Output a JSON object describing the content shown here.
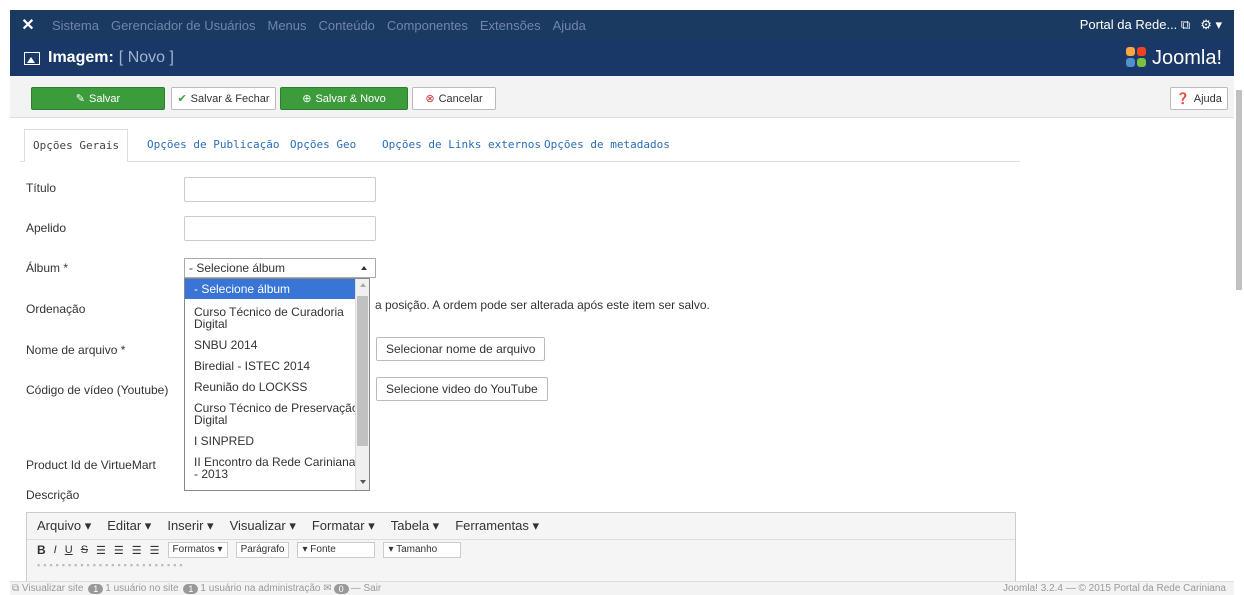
{
  "topbar": {
    "menu": [
      "Sistema",
      "Gerenciador de Usuários",
      "Menus",
      "Conteúdo",
      "Componentes",
      "Extensões",
      "Ajuda"
    ],
    "site_link": "Portal da Rede...",
    "settings": "⚙ ▾"
  },
  "header": {
    "title": "Imagem:",
    "subtitle": "[ Novo ]",
    "logo_text": "Joomla!"
  },
  "toolbar": {
    "save": "Salvar",
    "save_close": "Salvar & Fechar",
    "save_new": "Salvar & Novo",
    "cancel": "Cancelar",
    "help": "Ajuda"
  },
  "tabs": [
    "Opções Gerais",
    "Opções de Publicação",
    "Opções Geo",
    "Opções de Links externos",
    "Opções de metadados"
  ],
  "form": {
    "titulo_label": "Título",
    "apelido_label": "Apelido",
    "album_label": "Álbum *",
    "album_selected": "- Selecione álbum",
    "ordenacao_label": "Ordenação",
    "ordenacao_hint": "a posição. A ordem pode ser alterada após este item ser salvo.",
    "arquivo_label": "Nome de arquivo *",
    "arquivo_button": "Selecionar nome de arquivo",
    "video_label": "Código de vídeo (Youtube)",
    "video_button": "Selecione video do YouTube",
    "virtuemart_label": "Product Id de VirtueMart",
    "descricao_label": "Descrição"
  },
  "album_options": [
    "- Selecione álbum",
    "Curso Técnico de Curadoria Digital",
    "SNBU 2014",
    "Biredial - ISTEC 2014",
    "Reunião do LOCKSS",
    "Curso Técnico de Preservação Digital",
    "I SINPRED",
    "II Encontro da Rede Cariniana - 2013"
  ],
  "editor": {
    "menu": [
      "Arquivo ▾",
      "Editar ▾",
      "Inserir ▾",
      "Visualizar ▾",
      "Formatar ▾",
      "Tabela ▾",
      "Ferramentas ▾"
    ],
    "formats": "Formatos ▾",
    "paragraph": "Parágrafo",
    "font": "▾  Fonte",
    "size": "▾  Tamanho"
  },
  "footer": {
    "view_site": "Visualizar site",
    "users_site_count": "1",
    "users_site": "1 usuário no site",
    "users_admin_count": "1",
    "users_admin": "1 usuário na administração",
    "messages_count": "0",
    "logout": "Sair",
    "version": "Joomla! 3.2.4 — © 2015 Portal da Rede Cariniana"
  },
  "colors": {
    "topbar": "#1b3a61",
    "header": "#1a3867",
    "green": "#3c9c3c",
    "link": "#2a6db5",
    "selected": "#3875d7"
  }
}
